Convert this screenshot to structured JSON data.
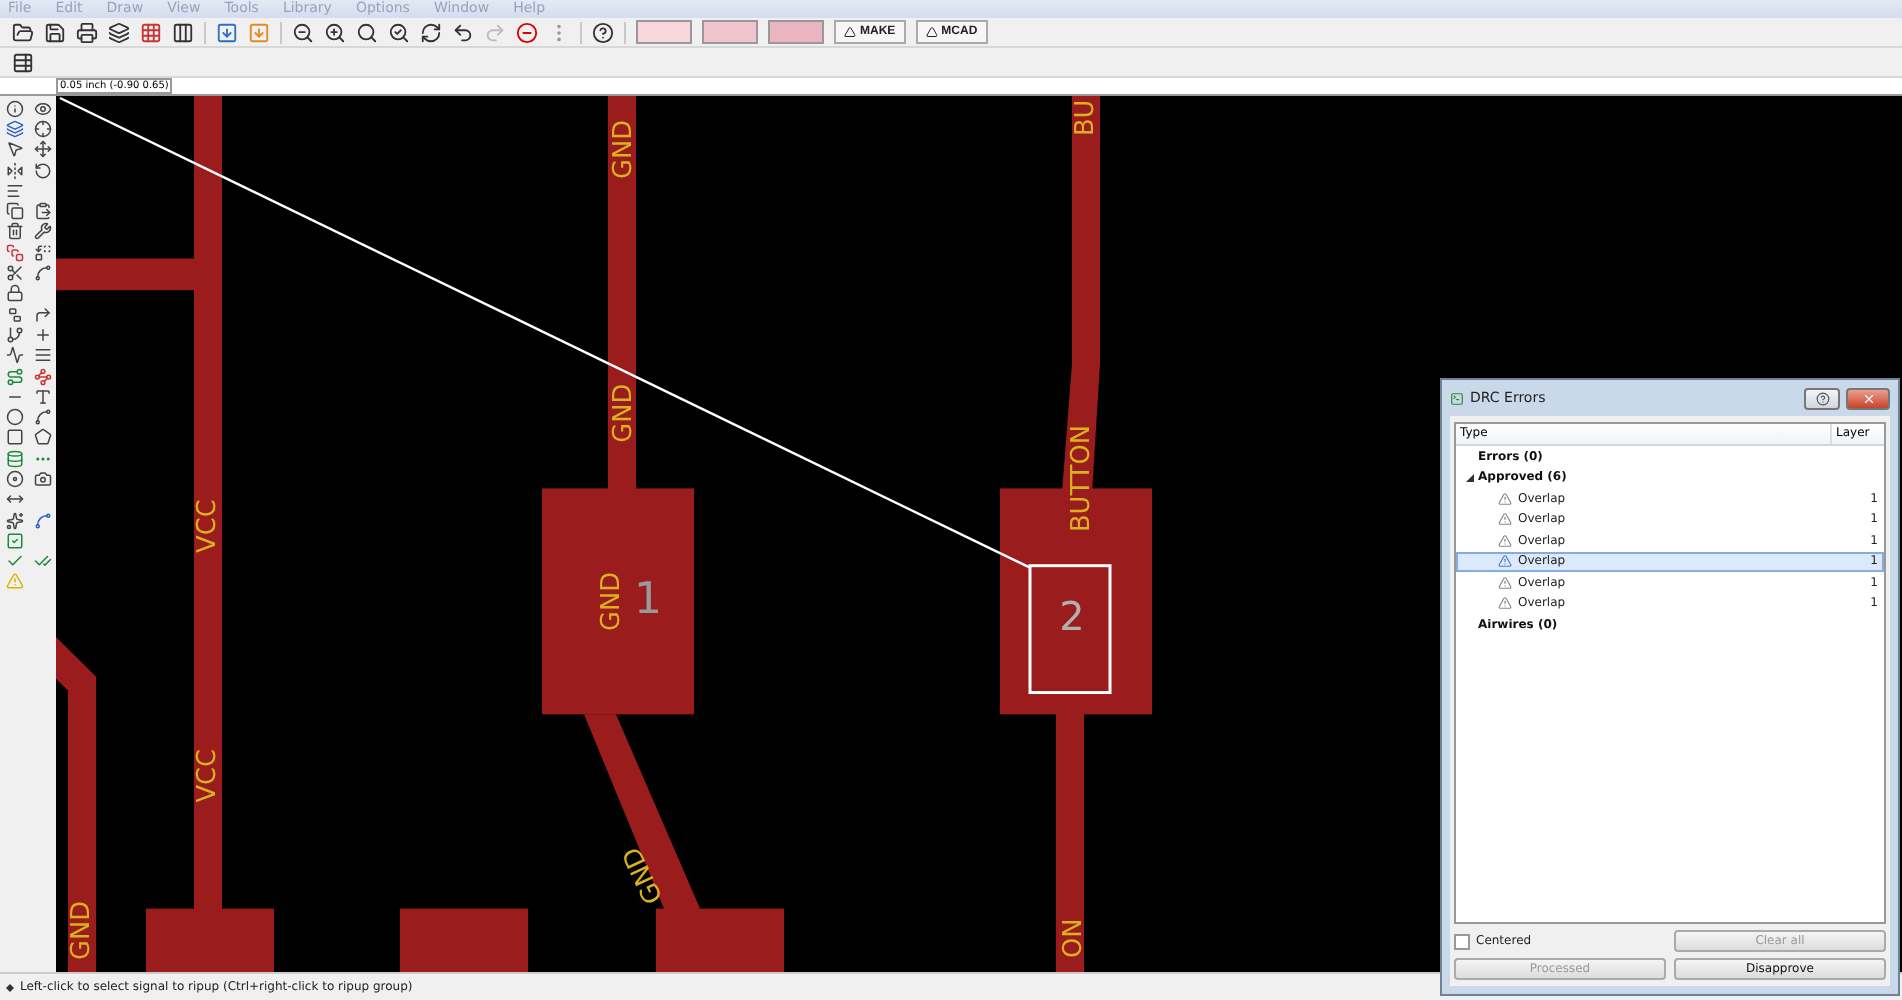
{
  "menu": [
    "File",
    "Edit",
    "Draw",
    "View",
    "Tools",
    "Library",
    "Options",
    "Window",
    "Help"
  ],
  "toolbar": {
    "buttons": [
      "MAKE",
      "MCAD"
    ]
  },
  "coordinate_field": {
    "value": "0.05 inch (-0.90 0.65)"
  },
  "canvas": {
    "labels": [
      {
        "text": "GND"
      },
      {
        "text": "BU"
      },
      {
        "text": "VCC"
      },
      {
        "text": "GND"
      },
      {
        "text": "BUTTON"
      },
      {
        "text": "GND"
      },
      {
        "text": "1"
      },
      {
        "text": "2"
      },
      {
        "text": "VCC"
      },
      {
        "text": "GND"
      },
      {
        "text": "GND"
      },
      {
        "text": "ON"
      }
    ]
  },
  "drc_dialog": {
    "title": "DRC Errors",
    "columns": [
      "Type",
      "Layer"
    ],
    "groups": [
      {
        "label": "Errors (0)",
        "expanded": false
      },
      {
        "label": "Approved (6)",
        "expanded": true,
        "children": [
          {
            "label": "Overlap",
            "layer": "1",
            "selected": false
          },
          {
            "label": "Overlap",
            "layer": "1",
            "selected": false
          },
          {
            "label": "Overlap",
            "layer": "1",
            "selected": false
          },
          {
            "label": "Overlap",
            "layer": "1",
            "selected": true
          },
          {
            "label": "Overlap",
            "layer": "1",
            "selected": false
          },
          {
            "label": "Overlap",
            "layer": "1",
            "selected": false
          }
        ]
      },
      {
        "label": "Airwires (0)",
        "expanded": false
      }
    ],
    "centered": {
      "label": "Centered",
      "checked": false
    },
    "buttons": [
      {
        "label": "Clear all",
        "disabled": true
      },
      {
        "label": "Processed",
        "disabled": true
      },
      {
        "label": "Disapprove",
        "disabled": false
      }
    ]
  },
  "status_bar": {
    "text": "Left-click to select signal to ripup (Ctrl+right-click to ripup group)"
  }
}
